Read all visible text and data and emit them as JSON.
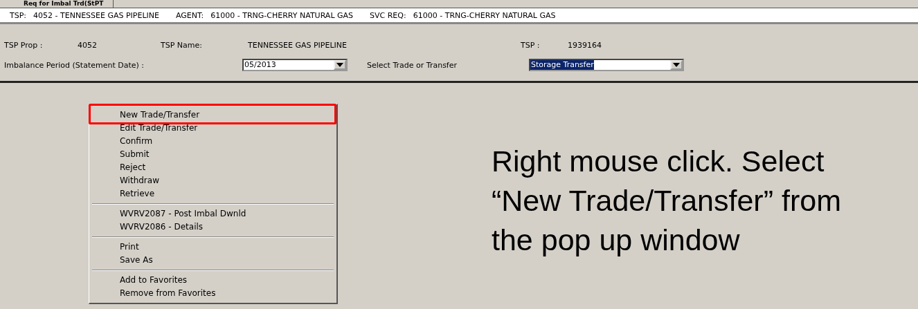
{
  "tab": {
    "label": "Req for Imbal Trd(StPT"
  },
  "info_bar": [
    {
      "label": "TSP:",
      "value": "4052 - TENNESSEE GAS PIPELINE"
    },
    {
      "label": "AGENT:",
      "value": "61000 - TRNG-CHERRY NATURAL GAS"
    },
    {
      "label": "SVC REQ:",
      "value": "61000 - TRNG-CHERRY NATURAL GAS"
    }
  ],
  "header": {
    "tsp_prop_label": "TSP Prop :",
    "tsp_prop": "4052",
    "tsp_name_label": "TSP Name:",
    "tsp_name": "TENNESSEE GAS PIPELINE",
    "tsp_label": "TSP :",
    "tsp": "1939164",
    "period_label": "Imbalance Period (Statement Date) :",
    "period": "05/2013",
    "trade_label": "Select Trade or Transfer",
    "trade": "Storage Transfer"
  },
  "context_menu": [
    [
      {
        "label": "New Trade/Transfer",
        "highlighted": true
      },
      {
        "label": "Edit Trade/Transfer",
        "highlighted": false
      },
      {
        "label": "Confirm",
        "highlighted": false
      },
      {
        "label": "Submit",
        "highlighted": false
      },
      {
        "label": "Reject",
        "highlighted": false
      },
      {
        "label": "Withdraw",
        "highlighted": false
      },
      {
        "label": "Retrieve",
        "highlighted": false
      }
    ],
    [
      {
        "label": "WVRV2087 - Post Imbal Dwnld",
        "highlighted": false
      },
      {
        "label": "WVRV2086 - Details",
        "highlighted": false
      }
    ],
    [
      {
        "label": "Print",
        "highlighted": false
      },
      {
        "label": "Save As",
        "highlighted": false
      }
    ],
    [
      {
        "label": "Add to Favorites",
        "highlighted": false
      },
      {
        "label": "Remove from Favorites",
        "highlighted": false
      }
    ]
  ],
  "instruction": [
    "Right mouse click. Select",
    "“New Trade/Transfer” from",
    "the pop up window"
  ]
}
